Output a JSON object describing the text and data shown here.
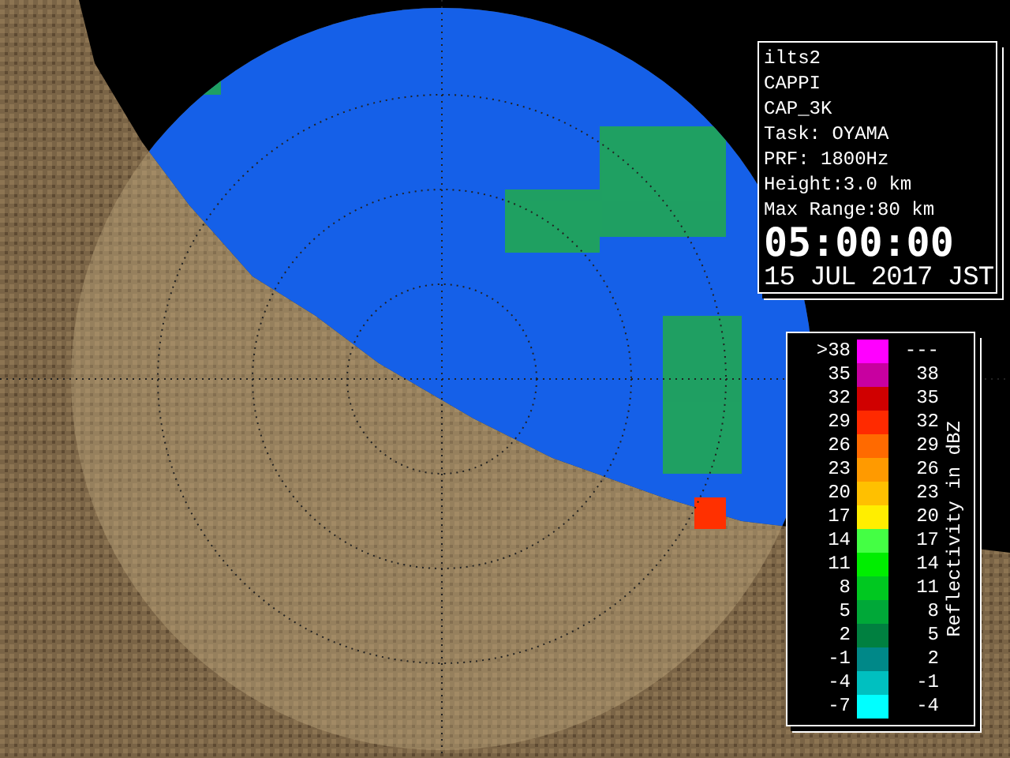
{
  "info_panel": {
    "lines": [
      "ilts2",
      "CAPPI",
      "CAP_3K",
      "Task: OYAMA",
      "PRF: 1800Hz",
      "Height:3.0 km",
      "Max Range:80 km"
    ],
    "time": "05:00:00",
    "date": "15 JUL 2017 JST"
  },
  "legend": {
    "title": "Reflectivity in dBZ",
    "rows": [
      {
        "low": ">38",
        "high": "---",
        "color": "#ff00ff"
      },
      {
        "low": "35",
        "high": "38",
        "color": "#c800a0"
      },
      {
        "low": "32",
        "high": "35",
        "color": "#d00000"
      },
      {
        "low": "29",
        "high": "32",
        "color": "#ff2a00"
      },
      {
        "low": "26",
        "high": "29",
        "color": "#ff6a00"
      },
      {
        "low": "23",
        "high": "26",
        "color": "#ff9a00"
      },
      {
        "low": "20",
        "high": "23",
        "color": "#ffc000"
      },
      {
        "low": "17",
        "high": "20",
        "color": "#ffee00"
      },
      {
        "low": "14",
        "high": "17",
        "color": "#44ff44"
      },
      {
        "low": "11",
        "high": "14",
        "color": "#00ee00"
      },
      {
        "low": "8",
        "high": "11",
        "color": "#00c820"
      },
      {
        "low": "5",
        "high": "8",
        "color": "#00a838"
      },
      {
        "low": "2",
        "high": "5",
        "color": "#008040"
      },
      {
        "low": "-1",
        "high": "2",
        "color": "#008888"
      },
      {
        "low": "-4",
        "high": "-1",
        "color": "#00c0c0"
      },
      {
        "low": "-7",
        "high": "-4",
        "color": "#00ffff"
      }
    ]
  }
}
